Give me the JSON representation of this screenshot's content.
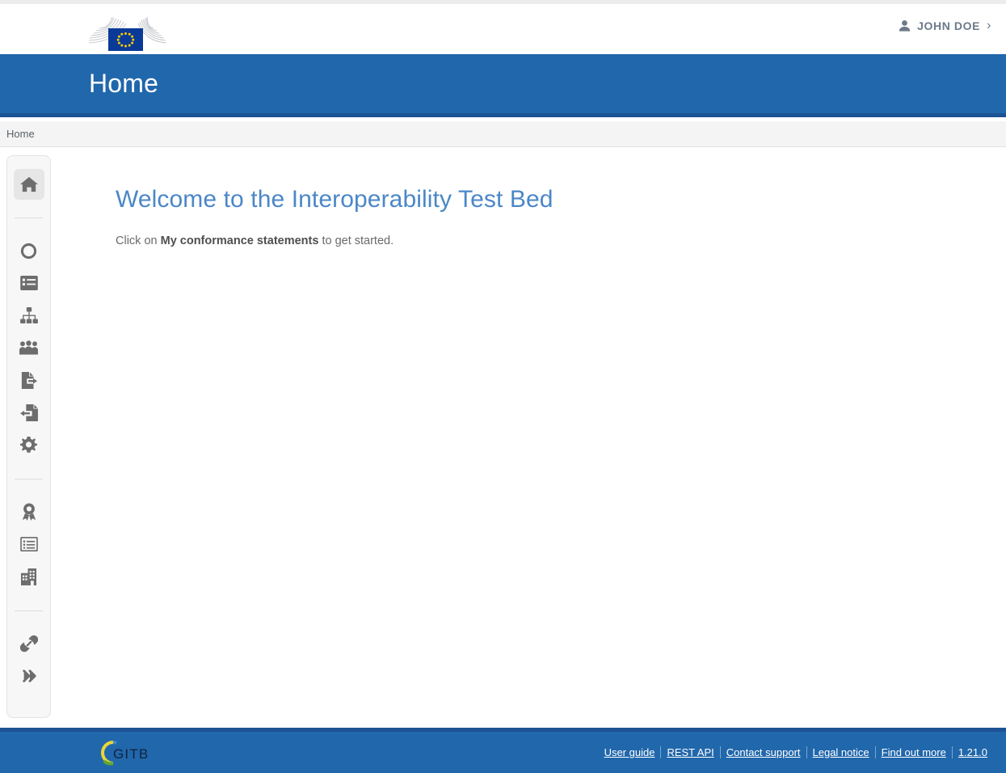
{
  "topbar": {
    "logo_alt": "European Commission",
    "user": {
      "name": "JOHN DOE",
      "icon": "user-icon",
      "chevron": "›"
    }
  },
  "header": {
    "title": "Home",
    "background_color": "#2167ab",
    "border_color": "#1d5394"
  },
  "breadcrumb": {
    "items": [
      {
        "label": "Home"
      }
    ]
  },
  "sidebar": {
    "groups": [
      {
        "items": [
          {
            "label": "Home",
            "icon": "home-icon",
            "active": true
          }
        ]
      },
      {
        "items": [
          {
            "label": "Dashboard",
            "icon": "tachometer-icon",
            "active": false
          },
          {
            "label": "Conformance statements",
            "icon": "list-icon",
            "active": false
          },
          {
            "label": "Domains",
            "icon": "sitemap-icon",
            "active": false
          },
          {
            "label": "Communities",
            "icon": "users-icon",
            "active": false
          },
          {
            "label": "Export",
            "icon": "file-export-icon",
            "active": false
          },
          {
            "label": "Import",
            "icon": "file-import-icon",
            "active": false
          },
          {
            "label": "Settings",
            "icon": "gear-icon",
            "active": false
          }
        ]
      },
      {
        "items": [
          {
            "label": "Conformance certificates",
            "icon": "award-icon",
            "active": false
          },
          {
            "label": "Sessions",
            "icon": "list-alt-icon",
            "active": false
          },
          {
            "label": "Organisations",
            "icon": "building-icon",
            "active": false
          }
        ]
      },
      {
        "items": [
          {
            "label": "Links",
            "icon": "link-icon",
            "active": false
          },
          {
            "label": "Expand menu",
            "icon": "double-chevron-right-icon",
            "active": false
          }
        ]
      }
    ]
  },
  "main": {
    "title": "Welcome to the Interoperability Test Bed",
    "intro_prefix": "Click on ",
    "intro_strong": "My conformance statements",
    "intro_suffix": " to get started.",
    "title_color": "#4b87c7"
  },
  "footer": {
    "logo_text": "GITB",
    "links": [
      {
        "label": "User guide"
      },
      {
        "label": "REST API"
      },
      {
        "label": "Contact support"
      },
      {
        "label": "Legal notice"
      },
      {
        "label": "Find out more"
      },
      {
        "label": "1.21.0"
      }
    ],
    "background_color": "#2167ab"
  }
}
